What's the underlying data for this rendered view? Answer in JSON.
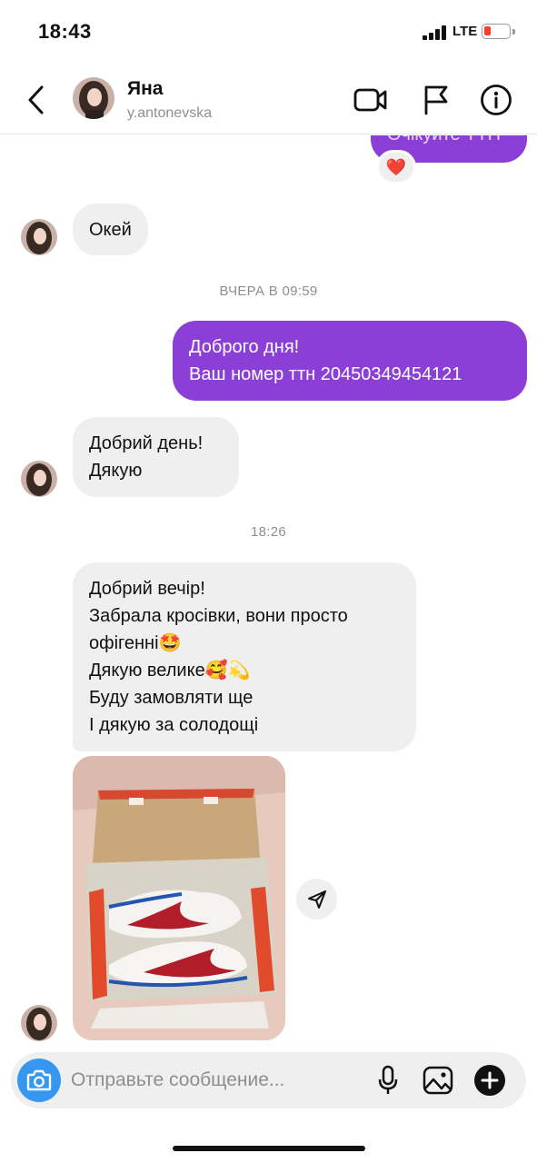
{
  "status_bar": {
    "time": "18:43",
    "network": "LTE"
  },
  "header": {
    "back_icon": "chevron-left-icon",
    "contact_name": "Яна",
    "contact_username": "y.antonevska",
    "video_call_icon": "video-camera-icon",
    "report_icon": "flag-icon",
    "info_icon": "info-icon"
  },
  "messages": [
    {
      "direction": "out",
      "text": "Очікуйте ТТН",
      "reaction": "❤️"
    },
    {
      "direction": "in",
      "text": "Окей"
    },
    {
      "type": "timestamp",
      "text": "ВЧЕРА В 09:59"
    },
    {
      "direction": "out",
      "text": "Доброго дня!\nВаш номер ттн 20450349454121"
    },
    {
      "direction": "in",
      "text": "Добрий день!\nДякую"
    },
    {
      "type": "timestamp",
      "text": "18:26"
    },
    {
      "direction": "in",
      "text": "Добрий вечір!\nЗабрала кросівки, вони просто офігенні🤩\nДякую велике🥰💫\nБуду замовляти ще\nІ дякую за солодощі"
    },
    {
      "direction": "in",
      "type": "photo",
      "depicts": "sneakers-in-box"
    }
  ],
  "composer": {
    "placeholder": "Отправьте сообщение...",
    "camera_icon": "camera-icon",
    "mic_icon": "microphone-icon",
    "gallery_icon": "image-icon",
    "add_icon": "plus-circle-icon"
  },
  "colors": {
    "outgoing_bubble": "#8b3fd6",
    "incoming_bubble": "#efefef",
    "camera_button": "#3797f0",
    "timestamp_text": "#8e8e8e"
  }
}
